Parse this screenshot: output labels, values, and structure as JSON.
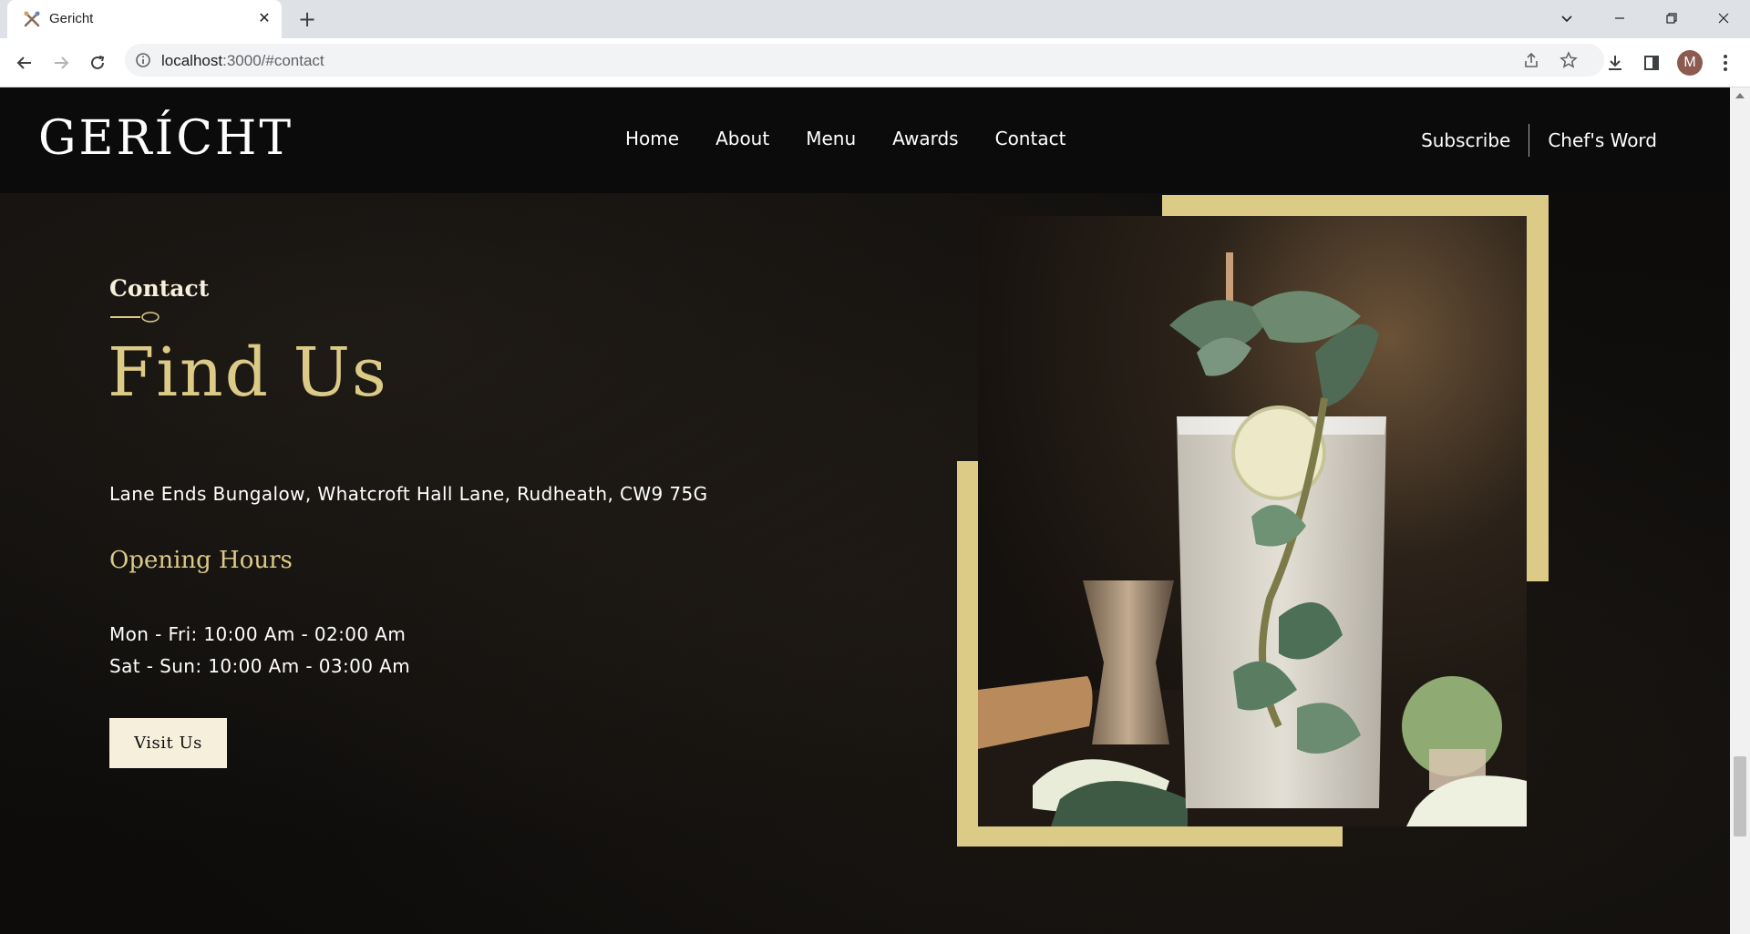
{
  "browser": {
    "tab_title": "Gericht",
    "url_host": "localhost",
    "url_rest": ":3000/#contact",
    "avatar_letter": "M"
  },
  "site": {
    "logo": "GERÍCHT",
    "nav": [
      "Home",
      "About",
      "Menu",
      "Awards",
      "Contact"
    ],
    "subscribe": "Subscribe",
    "chefs_word": "Chef's Word"
  },
  "contact": {
    "subtitle": "Contact",
    "heading": "Find Us",
    "address": "Lane Ends Bungalow, Whatcroft Hall Lane, Rudheath, CW9 75G",
    "hours_title": "Opening Hours",
    "hours": [
      "Mon - Fri: 10:00 Am - 02:00 Am",
      "Sat - Sun: 10:00 Am - 03:00 Am"
    ],
    "button": "Visit Us"
  },
  "colors": {
    "gold": "#dcca87",
    "cream": "#f5efdb",
    "black": "#0c0c0c"
  },
  "icons": [
    "back-icon",
    "forward-icon",
    "reload-icon",
    "info-icon",
    "share-icon",
    "star-icon",
    "download-icon",
    "sidepanel-icon",
    "menu-icon",
    "spoon-icon"
  ]
}
